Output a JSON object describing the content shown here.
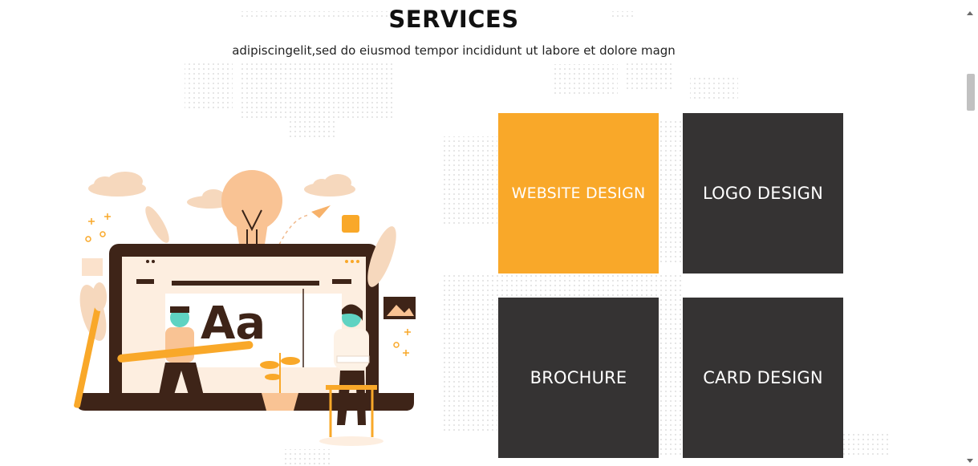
{
  "services": {
    "title": "SERVICES",
    "subtitle": "adipiscingelit,sed do eiusmod tempor incididunt ut labore et dolore magn"
  },
  "illustration": {
    "letters": "Aa"
  },
  "tiles": [
    {
      "label": "WEBSITE DESIGN",
      "active": true
    },
    {
      "label": "LOGO DESIGN",
      "active": false
    },
    {
      "label": "BROCHURE",
      "active": false
    },
    {
      "label": "CARD DESIGN",
      "active": false
    }
  ],
  "colors": {
    "accent": "#f9a829",
    "tile_dark": "#353333",
    "text_dark": "#111111"
  },
  "icons": {
    "scroll_up": "triangle-up-icon",
    "scroll_down": "triangle-down-icon"
  }
}
